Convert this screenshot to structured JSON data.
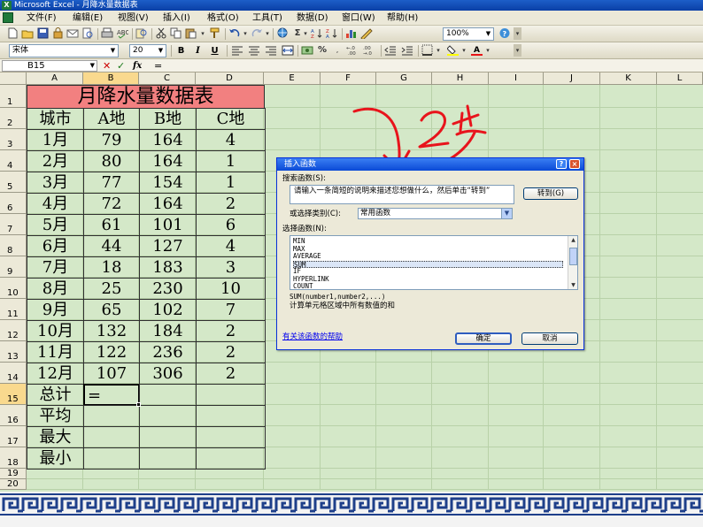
{
  "window": {
    "title": "Microsoft Excel - 月降水量数据表"
  },
  "menu": [
    "文件(F)",
    "编辑(E)",
    "视图(V)",
    "插入(I)",
    "格式(O)",
    "工具(T)",
    "数据(D)",
    "窗口(W)",
    "帮助(H)"
  ],
  "toolbar": {
    "zoom": "100%",
    "font_name": "宋体",
    "font_size": "20",
    "bold_label": "B",
    "italic_label": "I",
    "underline_label": "U",
    "sum_label": "Σ",
    "percent_label": "%"
  },
  "formula_bar": {
    "name_box": "B15",
    "cancel_icon": "✕",
    "enter_icon": "✓",
    "fx_label": "fx",
    "content": "="
  },
  "columns": [
    "A",
    "B",
    "C",
    "D",
    "E",
    "F",
    "G",
    "H",
    "I",
    "J",
    "K",
    "L"
  ],
  "rows": [
    "1",
    "2",
    "3",
    "4",
    "5",
    "6",
    "7",
    "8",
    "9",
    "10",
    "11",
    "12",
    "13",
    "14",
    "15",
    "16",
    "17",
    "18",
    "19",
    "20"
  ],
  "sheet": {
    "title": "月降水量数据表",
    "header": [
      "城市",
      "A地",
      "B地",
      "C地"
    ],
    "data": [
      [
        "1月",
        "79",
        "164",
        "4"
      ],
      [
        "2月",
        "80",
        "164",
        "1"
      ],
      [
        "3月",
        "77",
        "154",
        "1"
      ],
      [
        "4月",
        "72",
        "164",
        "2"
      ],
      [
        "5月",
        "61",
        "101",
        "6"
      ],
      [
        "6月",
        "44",
        "127",
        "4"
      ],
      [
        "7月",
        "18",
        "183",
        "3"
      ],
      [
        "8月",
        "25",
        "230",
        "10"
      ],
      [
        "9月",
        "65",
        "102",
        "7"
      ],
      [
        "10月",
        "132",
        "184",
        "2"
      ],
      [
        "11月",
        "122",
        "236",
        "2"
      ],
      [
        "12月",
        "107",
        "306",
        "2"
      ]
    ],
    "summary_rows": [
      {
        "label": "总计",
        "b": "=",
        "c": "",
        "d": ""
      },
      {
        "label": "平均",
        "b": "",
        "c": "",
        "d": ""
      },
      {
        "label": "最大",
        "b": "",
        "c": "",
        "d": ""
      },
      {
        "label": "最小",
        "b": "",
        "c": "",
        "d": ""
      }
    ]
  },
  "dialog": {
    "title": "插入函数",
    "search_label": "搜索函数(S):",
    "search_text": "请输入一条简短的说明来描述您想做什么，然后单击“转到”",
    "goto_button": "转到(G)",
    "category_label": "或选择类别(C):",
    "category_value": "常用函数",
    "function_list_label": "选择函数(N):",
    "functions": [
      "MIN",
      "MAX",
      "AVERAGE",
      "SUM",
      "IF",
      "HYPERLINK",
      "COUNT"
    ],
    "selected_function": "SUM",
    "syntax": "SUM(number1,number2,...)",
    "description": "计算单元格区域中所有数值的和",
    "help_link": "有关该函数的帮助",
    "ok_button": "确定",
    "cancel_button": "取消",
    "help_button": "?",
    "close_button": "×"
  },
  "annotation": {
    "handwritten_step": "2步",
    "ink_color": "#e8141c"
  },
  "colors": {
    "title_fill": "#f28080",
    "grid_bg": "#d4e8c8",
    "selected_header": "#f9d98e",
    "dialog_title": "#0a49d6"
  }
}
